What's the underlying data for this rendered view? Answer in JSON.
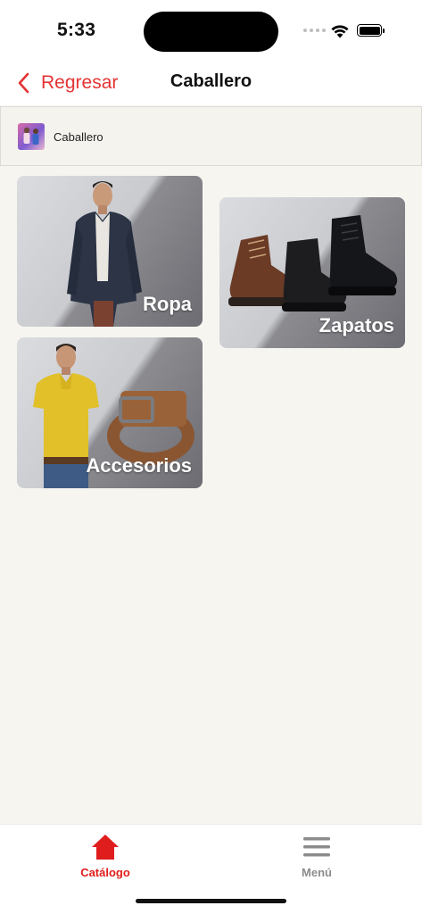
{
  "status_bar": {
    "time": "5:33",
    "icons": [
      "signal-dots-icon",
      "wifi-icon",
      "battery-icon"
    ]
  },
  "nav": {
    "back_label": "Regresar",
    "title": "Caballero",
    "accent_color": "#e53333"
  },
  "breadcrumb": {
    "label": "Caballero"
  },
  "categories": [
    {
      "label": "Ropa"
    },
    {
      "label": "Zapatos"
    },
    {
      "label": "Accesorios"
    }
  ],
  "tabs": [
    {
      "label": "Catálogo",
      "icon": "home-icon",
      "active": true,
      "color": "#e01d1d"
    },
    {
      "label": "Menú",
      "icon": "hamburger-menu-icon",
      "active": false,
      "color": "#8c8c8c"
    }
  ]
}
